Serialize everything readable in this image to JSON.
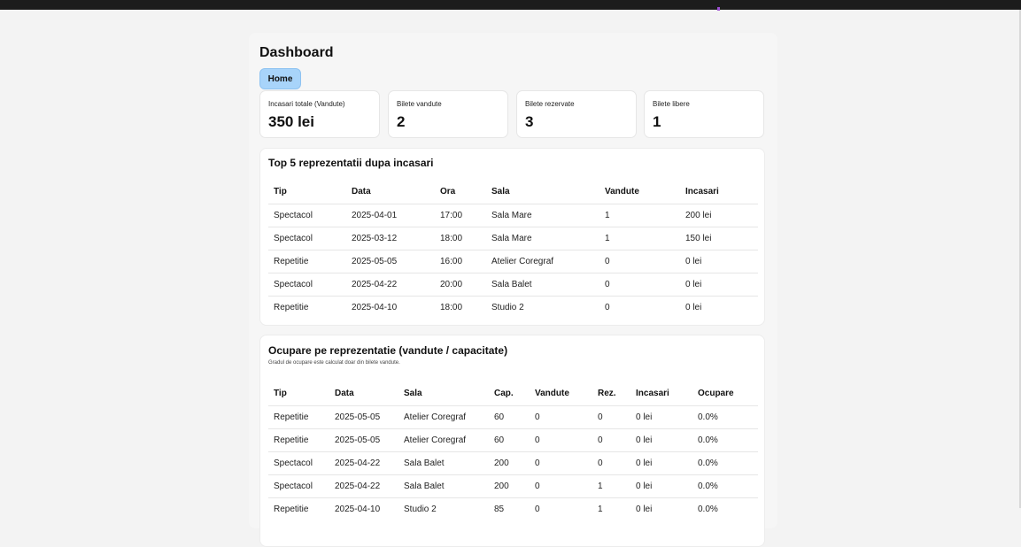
{
  "dashboard": {
    "title": "Dashboard",
    "home_label": "Home"
  },
  "stats": [
    {
      "label": "Incasari totale (Vandute)",
      "value": "350 lei"
    },
    {
      "label": "Bilete vandute",
      "value": "2"
    },
    {
      "label": "Bilete rezervate",
      "value": "3"
    },
    {
      "label": "Bilete libere",
      "value": "1"
    }
  ],
  "top5": {
    "title": "Top 5 reprezentatii dupa incasari",
    "headers": [
      "Tip",
      "Data",
      "Ora",
      "Sala",
      "Vandute",
      "Incasari"
    ],
    "rows": [
      [
        "Spectacol",
        "2025-04-01",
        "17:00",
        "Sala Mare",
        "1",
        "200 lei"
      ],
      [
        "Spectacol",
        "2025-03-12",
        "18:00",
        "Sala Mare",
        "1",
        "150 lei"
      ],
      [
        "Repetitie",
        "2025-05-05",
        "16:00",
        "Atelier Coregraf",
        "0",
        "0 lei"
      ],
      [
        "Spectacol",
        "2025-04-22",
        "20:00",
        "Sala Balet",
        "0",
        "0 lei"
      ],
      [
        "Repetitie",
        "2025-04-10",
        "18:00",
        "Studio 2",
        "0",
        "0 lei"
      ]
    ]
  },
  "occupancy": {
    "title": "Ocupare pe reprezentatie (vandute / capacitate)",
    "note": "Gradul de ocupare este calculat doar din bilete vandute.",
    "headers": [
      "Tip",
      "Data",
      "Sala",
      "Cap.",
      "Vandute",
      "Rez.",
      "Incasari",
      "Ocupare"
    ],
    "rows": [
      [
        "Repetitie",
        "2025-05-05",
        "Atelier Coregraf",
        "60",
        "0",
        "0",
        "0 lei",
        "0.0%"
      ],
      [
        "Repetitie",
        "2025-05-05",
        "Atelier Coregraf",
        "60",
        "0",
        "0",
        "0 lei",
        "0.0%"
      ],
      [
        "Spectacol",
        "2025-04-22",
        "Sala Balet",
        "200",
        "0",
        "0",
        "0 lei",
        "0.0%"
      ],
      [
        "Spectacol",
        "2025-04-22",
        "Sala Balet",
        "200",
        "0",
        "1",
        "0 lei",
        "0.0%"
      ],
      [
        "Repetitie",
        "2025-04-10",
        "Studio 2",
        "85",
        "0",
        "1",
        "0 lei",
        "0.0%"
      ]
    ]
  }
}
